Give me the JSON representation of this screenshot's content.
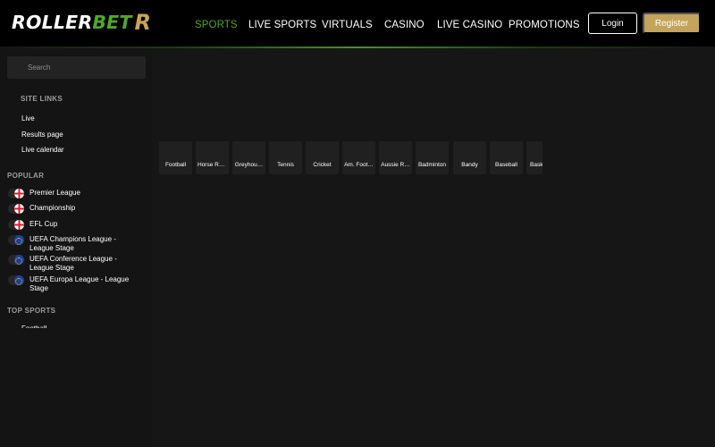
{
  "header": {
    "logo": {
      "text": "ROLLER",
      "accent": "BET",
      "mark": "R"
    },
    "nav": [
      {
        "label": "SPORTS",
        "active": true
      },
      {
        "label": "LIVE SPORTS",
        "active": false
      },
      {
        "label": "VIRTUALS",
        "active": false
      },
      {
        "label": "CASINO",
        "active": false
      },
      {
        "label": "LIVE CASINO",
        "active": false
      },
      {
        "label": "PROMOTIONS",
        "active": false
      }
    ],
    "login_label": "Login",
    "register_label": "Register"
  },
  "sidebar": {
    "search_placeholder": "Search",
    "site_links_title": "SITE LINKS",
    "site_links": [
      "Live",
      "Results page",
      "Live calendar"
    ],
    "popular_title": "POPULAR",
    "popular": [
      {
        "label": "Premier League",
        "flag": "england"
      },
      {
        "label": "Championship",
        "flag": "england"
      },
      {
        "label": "EFL Cup",
        "flag": "england"
      },
      {
        "label": "UEFA Champions League - League Stage",
        "flag": "europe"
      },
      {
        "label": "UEFA Conference League - League Stage",
        "flag": "europe"
      },
      {
        "label": "UEFA Europa League - League Stage",
        "flag": "europe"
      }
    ],
    "top_sports_title": "TOP SPORTS",
    "top_sports": [
      "Football"
    ]
  },
  "sports": [
    "Football",
    "Horse Ra…",
    "Greyhou…",
    "Tennis",
    "Cricket",
    "Am. Foot…",
    "Aussie R…",
    "Badminton",
    "Bandy",
    "Baseball",
    "Bask"
  ],
  "colors": {
    "accent": "#4fa82b",
    "gold": "#c4a45a",
    "bg": "#161616",
    "header": "#000000"
  }
}
